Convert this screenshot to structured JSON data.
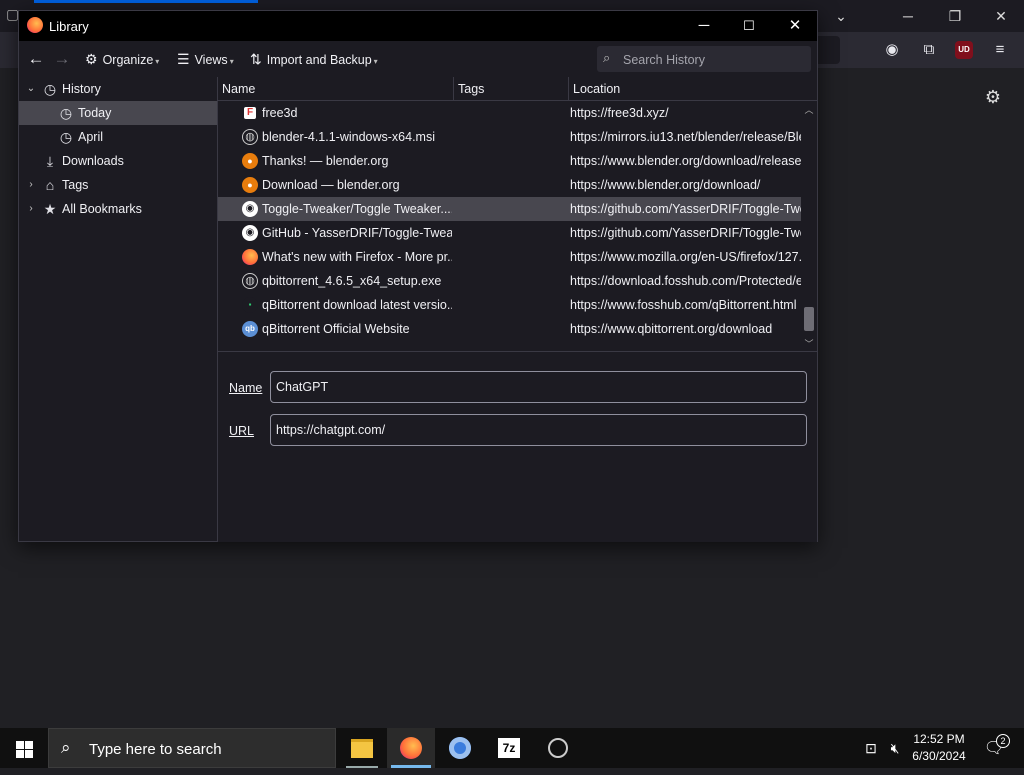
{
  "window": {
    "title": "Library",
    "controls": {
      "minimize": "─",
      "maximize": "☐",
      "close": "✕"
    }
  },
  "toolbar": {
    "back": "←",
    "forward": "→",
    "organize": "Organize",
    "views": "Views",
    "import_backup": "Import and Backup",
    "search_placeholder": "Search History"
  },
  "tree": [
    {
      "label": "History",
      "icon": "clock-icon",
      "expanded": true
    },
    {
      "label": "Today",
      "icon": "clock-icon",
      "selected": true
    },
    {
      "label": "April",
      "icon": "clock-icon"
    },
    {
      "label": "Downloads",
      "icon": "download-icon"
    },
    {
      "label": "Tags",
      "icon": "tag-icon",
      "expanded": false
    },
    {
      "label": "All Bookmarks",
      "icon": "star-icon",
      "expanded": false
    }
  ],
  "columns": {
    "name": "Name",
    "tags": "Tags",
    "location": "Location"
  },
  "rows": [
    {
      "name": "free3d",
      "tags": "",
      "location": "https://free3d.xyz/",
      "icon": "free3d-icon"
    },
    {
      "name": "blender-4.1.1-windows-x64.msi",
      "tags": "",
      "location": "https://mirrors.iu13.net/blender/release/Ble",
      "icon": "globe-icon"
    },
    {
      "name": "Thanks! — blender.org",
      "tags": "",
      "location": "https://www.blender.org/download/release,",
      "icon": "blender-icon"
    },
    {
      "name": "Download — blender.org",
      "tags": "",
      "location": "https://www.blender.org/download/",
      "icon": "blender-icon"
    },
    {
      "name": "Toggle-Tweaker/Toggle Tweaker....",
      "tags": "",
      "location": "https://github.com/YasserDRIF/Toggle-Twe.",
      "icon": "github-icon",
      "selected": true
    },
    {
      "name": "GitHub - YasserDRIF/Toggle-Twea...",
      "tags": "",
      "location": "https://github.com/YasserDRIF/Toggle-Twe.",
      "icon": "github-icon"
    },
    {
      "name": "What's new with Firefox - More pr...",
      "tags": "",
      "location": "https://www.mozilla.org/en-US/firefox/127.",
      "icon": "firefox-icon"
    },
    {
      "name": "qbittorrent_4.6.5_x64_setup.exe",
      "tags": "",
      "location": "https://download.fosshub.com/Protected/e",
      "icon": "globe-icon"
    },
    {
      "name": "qBittorrent download latest versio...",
      "tags": "",
      "location": "https://www.fosshub.com/qBittorrent.html",
      "icon": "fosshub-icon"
    },
    {
      "name": "qBittorrent Official Website",
      "tags": "",
      "location": "https://www.qbittorrent.org/download",
      "icon": "qbittorrent-icon"
    }
  ],
  "details": {
    "name_label": "Name",
    "name_value": "ChatGPT",
    "url_label": "URL",
    "url_value": "https://chatgpt.com/"
  },
  "browser": {
    "ublock_badge": "UD"
  },
  "taskbar": {
    "search_placeholder": "Type here to search",
    "time": "12:52 PM",
    "date": "6/30/2024",
    "notification_count": "2",
    "apps": [
      "file-explorer-icon",
      "firefox-icon",
      "chromium-icon",
      "7zip-icon",
      "obs-icon"
    ]
  },
  "colors": {
    "accent": "#0061e0",
    "selection": "#48474f",
    "background": "#1c1b22",
    "taskbar": "#101010"
  }
}
